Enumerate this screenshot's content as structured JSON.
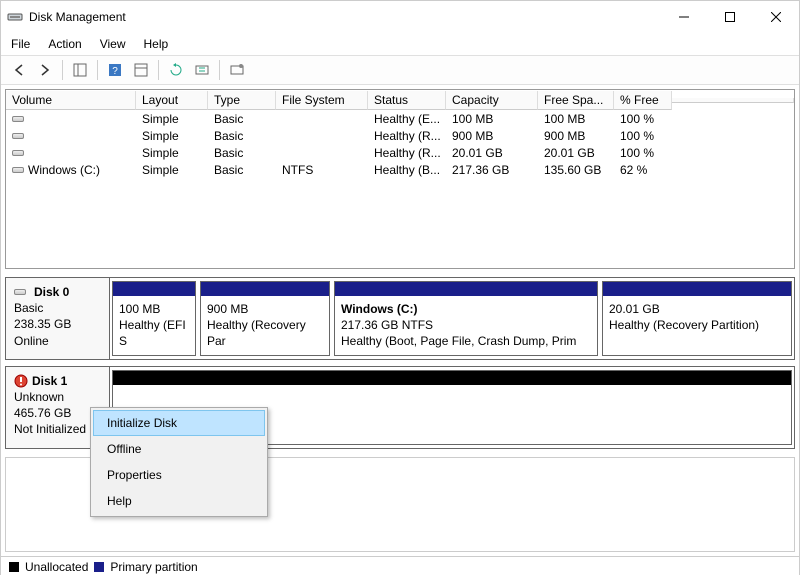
{
  "window": {
    "title": "Disk Management"
  },
  "menubar": {
    "file": "File",
    "action": "Action",
    "view": "View",
    "help": "Help"
  },
  "columns": {
    "volume": "Volume",
    "layout": "Layout",
    "type": "Type",
    "filesystem": "File System",
    "status": "Status",
    "capacity": "Capacity",
    "freespace": "Free Spa...",
    "pctfree": "% Free"
  },
  "volumes": [
    {
      "name": "",
      "layout": "Simple",
      "type": "Basic",
      "fs": "",
      "status": "Healthy (E...",
      "capacity": "100 MB",
      "free": "100 MB",
      "pct": "100 %"
    },
    {
      "name": "",
      "layout": "Simple",
      "type": "Basic",
      "fs": "",
      "status": "Healthy (R...",
      "capacity": "900 MB",
      "free": "900 MB",
      "pct": "100 %"
    },
    {
      "name": "",
      "layout": "Simple",
      "type": "Basic",
      "fs": "",
      "status": "Healthy (R...",
      "capacity": "20.01 GB",
      "free": "20.01 GB",
      "pct": "100 %"
    },
    {
      "name": "Windows (C:)",
      "layout": "Simple",
      "type": "Basic",
      "fs": "NTFS",
      "status": "Healthy (B...",
      "capacity": "217.36 GB",
      "free": "135.60 GB",
      "pct": "62 %"
    }
  ],
  "disks": {
    "disk0": {
      "title": "Disk 0",
      "type": "Basic",
      "size": "238.35 GB",
      "state": "Online",
      "parts": [
        {
          "line1": "",
          "line2": "100 MB",
          "line3": "Healthy (EFI S"
        },
        {
          "line1": "",
          "line2": "900 MB",
          "line3": "Healthy (Recovery Par"
        },
        {
          "line1": "Windows  (C:)",
          "line2": "217.36 GB NTFS",
          "line3": "Healthy (Boot, Page File, Crash Dump, Prim"
        },
        {
          "line1": "",
          "line2": "20.01 GB",
          "line3": "Healthy (Recovery Partition)"
        }
      ]
    },
    "disk1": {
      "title": "Disk 1",
      "type": "Unknown",
      "size": "465.76 GB",
      "state": "Not Initialized"
    }
  },
  "context_menu": {
    "initialize": "Initialize Disk",
    "offline": "Offline",
    "properties": "Properties",
    "help": "Help"
  },
  "legend": {
    "unallocated": "Unallocated",
    "primary": "Primary partition"
  }
}
